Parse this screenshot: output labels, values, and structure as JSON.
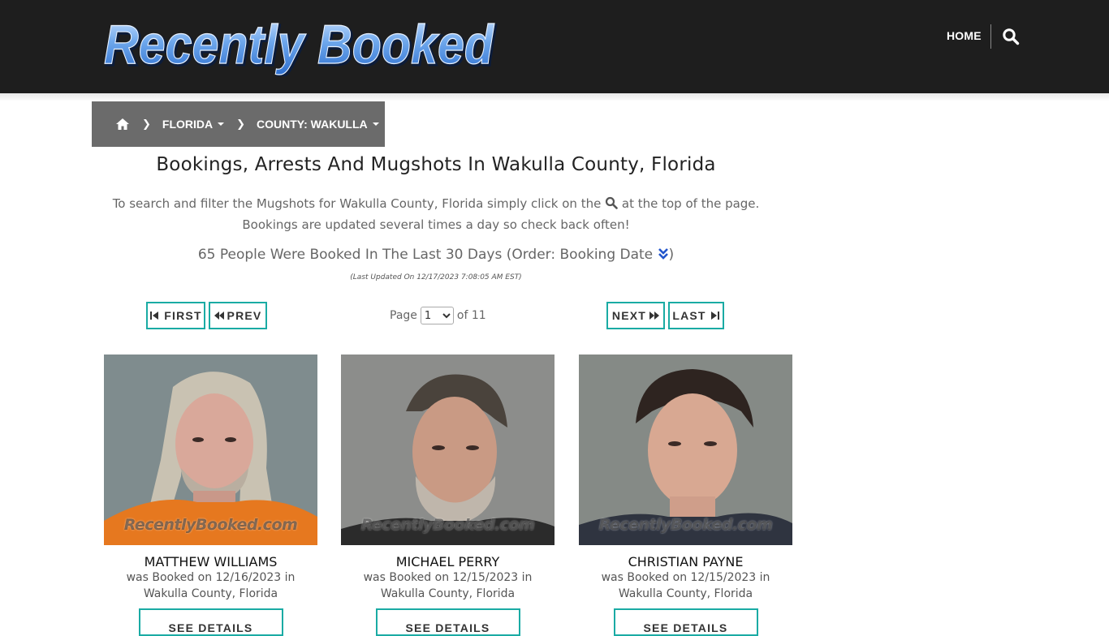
{
  "site": {
    "logo_text": "Recently Booked"
  },
  "nav": {
    "home": "HOME",
    "search_icon": "search-icon"
  },
  "breadcrumb": {
    "home_icon": "home-icon",
    "items": [
      {
        "label": "FLORIDA"
      },
      {
        "label": "COUNTY: WAKULLA"
      }
    ]
  },
  "page": {
    "title": "Bookings, Arrests And Mugshots In Wakulla County, Florida",
    "intro_line1_before": "To search and filter the Mugshots for Wakulla County, Florida simply click on the",
    "intro_line1_after": "at the top of the page.",
    "intro_line2": "Bookings are updated several times a day so check back often!",
    "count_text": "65 People Were Booked In The Last 30 Days (Order: Booking Date",
    "count_close": ")",
    "updated": "(Last Updated On 12/17/2023 7:08:05 AM EST)"
  },
  "pager": {
    "first": "FIRST",
    "prev": "PREV",
    "next": "NEXT",
    "last": "LAST",
    "page_label": "Page",
    "current_page": "1",
    "of_label": "of 11"
  },
  "bookings": [
    {
      "name": "MATTHEW WILLIAMS",
      "line1": "was Booked on 12/16/2023 in",
      "line2": "Wakulla County, Florida",
      "button": "SEE DETAILS",
      "watermark": "RecentlyBooked.com"
    },
    {
      "name": "MICHAEL PERRY",
      "line1": "was Booked on 12/15/2023 in",
      "line2": "Wakulla County, Florida",
      "button": "SEE DETAILS",
      "watermark": "RecentlyBooked.com"
    },
    {
      "name": "CHRISTIAN PAYNE",
      "line1": "was Booked on 12/15/2023 in",
      "line2": "Wakulla County, Florida",
      "button": "SEE DETAILS",
      "watermark": "RecentlyBooked.com"
    }
  ],
  "colors": {
    "header_bg": "#1e1e1e",
    "breadcrumb_bg": "#6b6b6b",
    "accent_teal": "#1aaba4",
    "order_icon_blue": "#2255cc"
  }
}
